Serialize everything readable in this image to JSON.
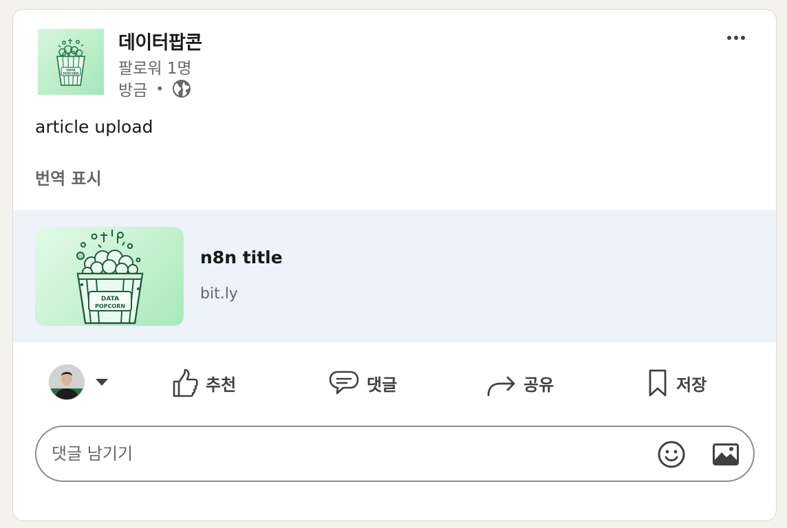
{
  "post": {
    "author": "데이터팝콘",
    "followers": "팔로워 1명",
    "time": "방금",
    "separator": "•",
    "text": "article upload",
    "translate_label": "번역 표시",
    "logo_text": [
      "DATA",
      "POPCORN"
    ]
  },
  "link_preview": {
    "title": "n8n title",
    "domain": "bit.ly",
    "image_text": [
      "DATA",
      "POPCORN"
    ]
  },
  "actions": {
    "like": "추천",
    "comment": "댓글",
    "share": "공유",
    "save": "저장"
  },
  "comment_box": {
    "placeholder": "댓글 남기기"
  },
  "icons": {
    "more": "more-horizontal-icon",
    "visibility": "globe-icon",
    "like": "thumbs-up-icon",
    "comment": "speech-bubble-icon",
    "share": "share-arrow-icon",
    "save": "bookmark-icon",
    "emoji": "smiley-icon",
    "image": "image-icon"
  },
  "colors": {
    "preview_background": "#edf3f8",
    "logo_green": "#b8eec6",
    "text_primary": "#191919",
    "text_secondary": "#666666"
  }
}
